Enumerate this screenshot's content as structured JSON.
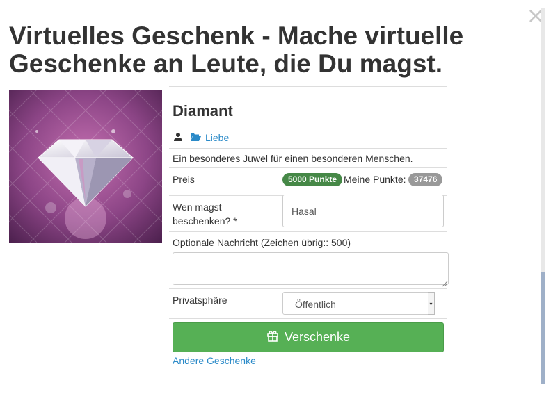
{
  "modal": {
    "close_glyph": "×",
    "title": "Virtuelles Geschenk - Mache virtuelle Geschenke an Leute, die Du magst."
  },
  "gift": {
    "name": "Diamant",
    "category": "Liebe",
    "description": "Ein besonderes Juwel für einen besonderen Menschen.",
    "image_icon": "diamond-gift-image"
  },
  "price": {
    "label": "Preis",
    "cost_badge": "5000 Punkte",
    "my_points_label": "Meine Punkte:",
    "my_points_value": "37476"
  },
  "recipient": {
    "label": "Wen magst beschenken? *",
    "value": "Hasal"
  },
  "message": {
    "label": "Optionale Nachricht (Zeichen übrig:: 500)",
    "value": ""
  },
  "privacy": {
    "label": "Privatsphäre",
    "selected": "Öffentlich"
  },
  "actions": {
    "give_label": "Verschenke",
    "other_gifts_label": "Andere Geschenke"
  },
  "colors": {
    "accent_link": "#2a8ac8",
    "success": "#56b055",
    "badge_green": "#468847",
    "badge_gray": "#999999"
  },
  "icons": [
    "close-icon",
    "user-icon",
    "folder-open-icon",
    "gift-icon",
    "resize-grip-icon",
    "caret-down-icon"
  ]
}
